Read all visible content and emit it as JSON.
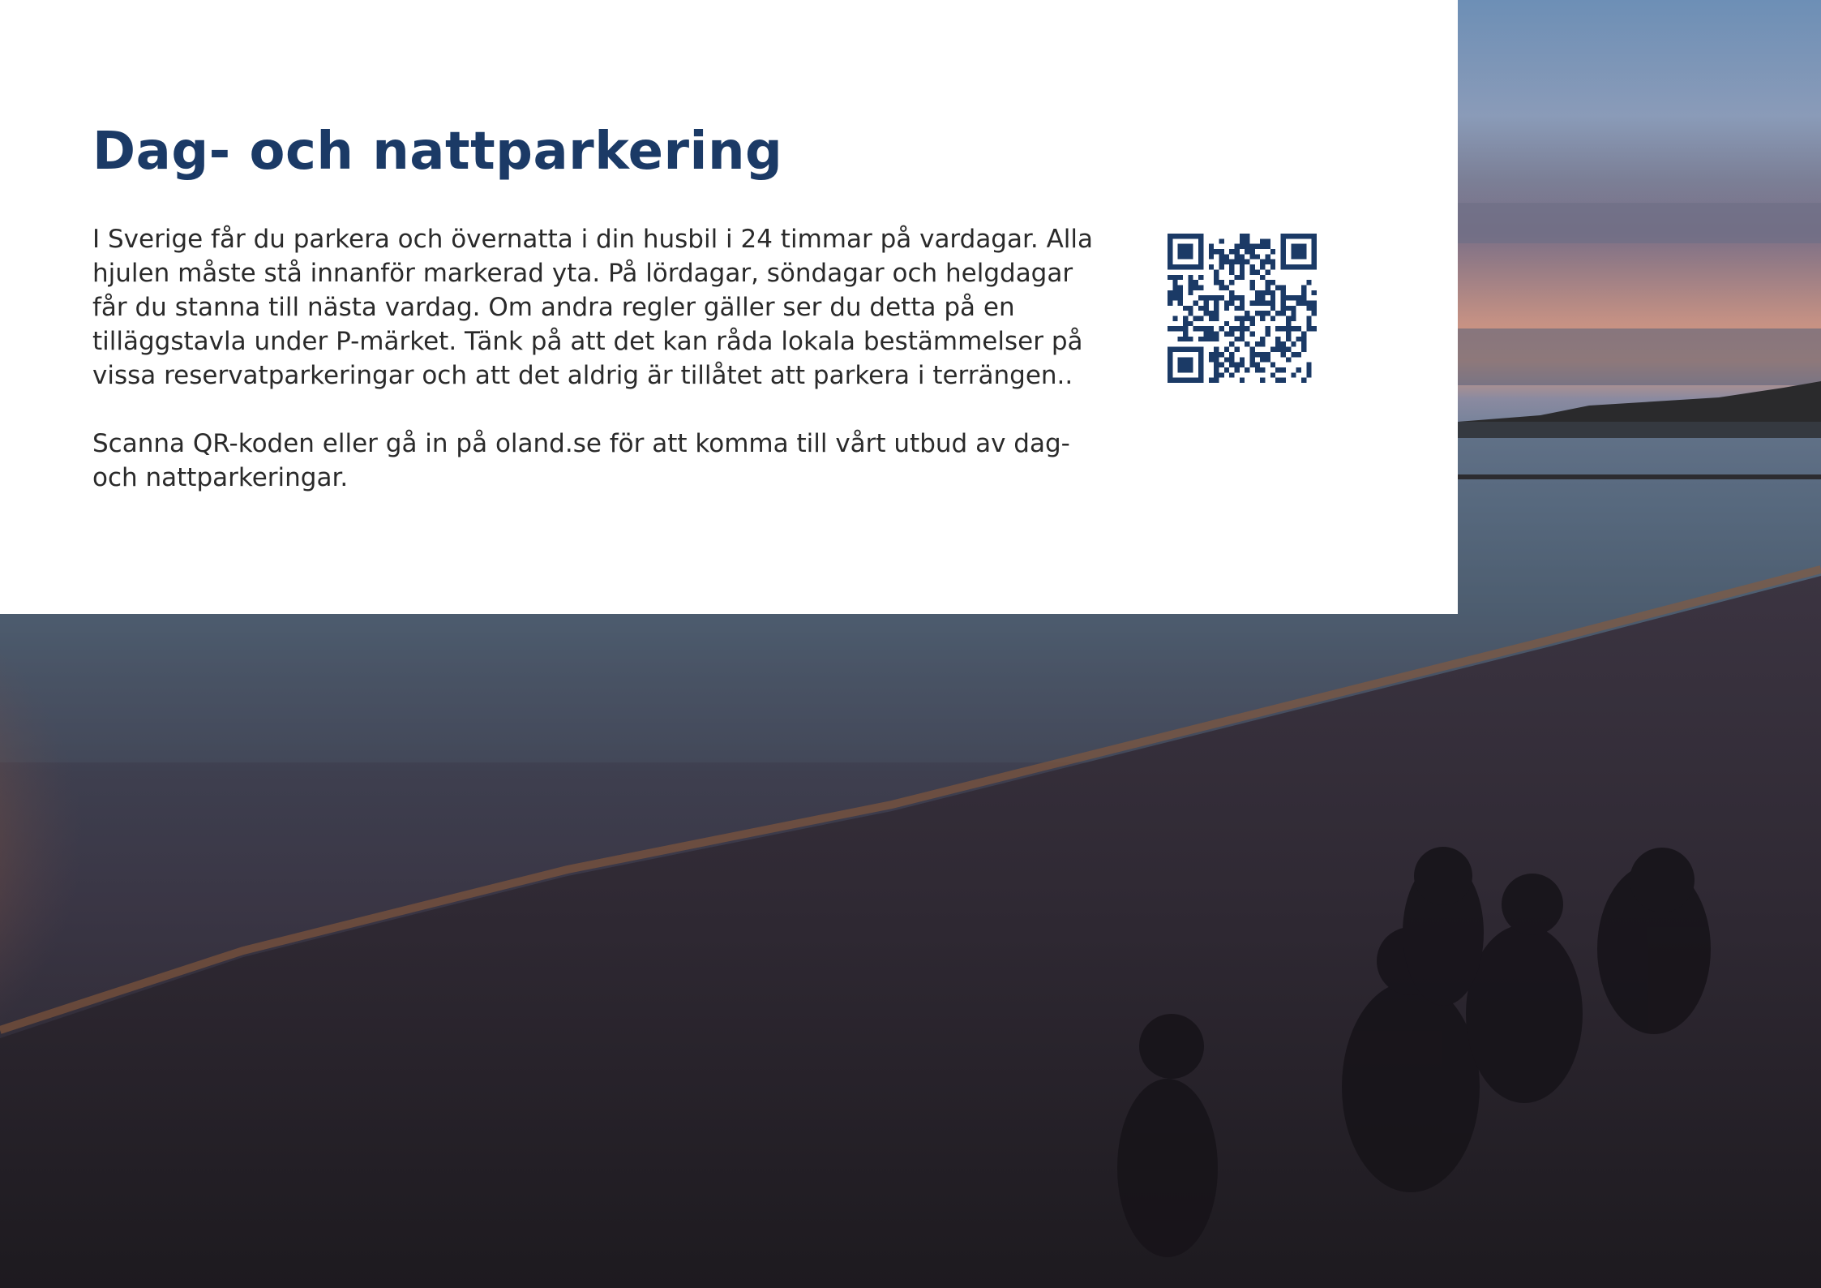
{
  "document": {
    "title": "Dag- och nattparkering",
    "paragraphs": [
      "I Sverige får du parkera och övernatta i din husbil i 24 timmar på vardagar. Alla hjulen måste stå innanför markerad yta. På lördagar, söndagar och helgdagar får du stanna till nästa vardag. Om andra regler gäller ser du detta på en tilläggstavla under P-märket. Tänk på att det kan råda lokala bestämmelser på vissa reservatparkeringar och att det aldrig är tillåtet att parkera i terrängen..",
      "Scanna QR-koden eller gå in på oland.se för att komma till vårt utbud av dag- och nattparkeringar."
    ]
  },
  "colors": {
    "title": "#1b3a66",
    "qr": "#1b3a66",
    "text": "#2a2a2a"
  },
  "icons": {
    "qr": "qr-code-icon"
  }
}
